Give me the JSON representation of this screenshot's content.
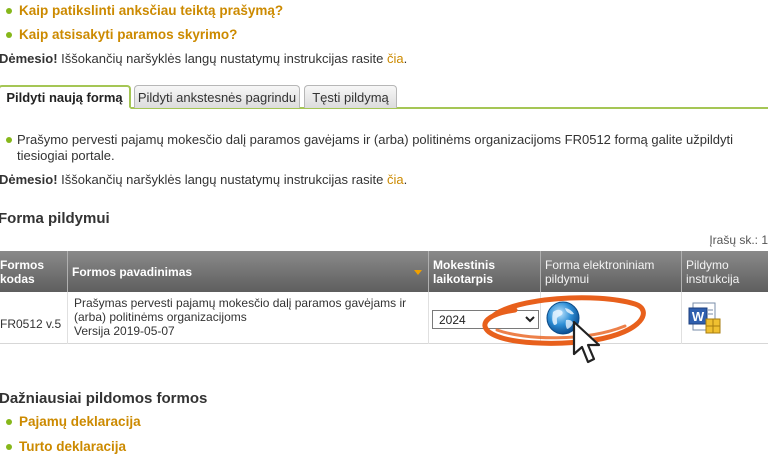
{
  "help_links": [
    "Kaip patikslinti anksčiau teiktą prašymą?",
    "Kaip atsisakyti paramos skyrimo?"
  ],
  "notice": {
    "bold": "Dėmesio!",
    "text": " Iššokančių naršyklės langų nustatymų instrukcijas rasite ",
    "link": "čia",
    "end": "."
  },
  "tabs": [
    "Pildyti naują formą",
    "Pildyti ankstesnės pagrindu",
    "Tęsti pildymą"
  ],
  "tab_content": {
    "text": "Prašymo pervesti pajamų mokesčio dalį paramos gavėjams ir (arba) politinėms organizacijoms FR0512 formą galite užpildyti tiesiogiai portale."
  },
  "section_title": "Forma pildymui",
  "record_count": "Įrašų sk.: 1",
  "table": {
    "headers": {
      "code": "Formos kodas",
      "name": "Formos pavadinimas",
      "period": "Mokestinis laikotarpis",
      "electronic": "Forma elektroniniam pildymui",
      "instructions": "Pildymo instrukcija"
    },
    "row": {
      "code": "FR0512 v.5",
      "name": "Prašymas pervesti pajamų mokesčio dalį paramos gavėjams ir (arba) politinėms organizacijoms",
      "version": "Versija 2019-05-07",
      "period_selected": "2024"
    }
  },
  "frequent_title": "Dažniausiai pildomos formos",
  "frequent_links": [
    "Pajamų deklaracija",
    "Turto deklaracija"
  ],
  "colors": {
    "link": "#cc8a00",
    "bullet": "#86b71a",
    "tab_border": "#a5c655",
    "header_bg": "#6b6b6b",
    "annotation": "#e8601c"
  },
  "icons": {
    "electronic": "globe-icon",
    "instructions": "word-document-icon",
    "pointer": "mouse-cursor-icon"
  }
}
